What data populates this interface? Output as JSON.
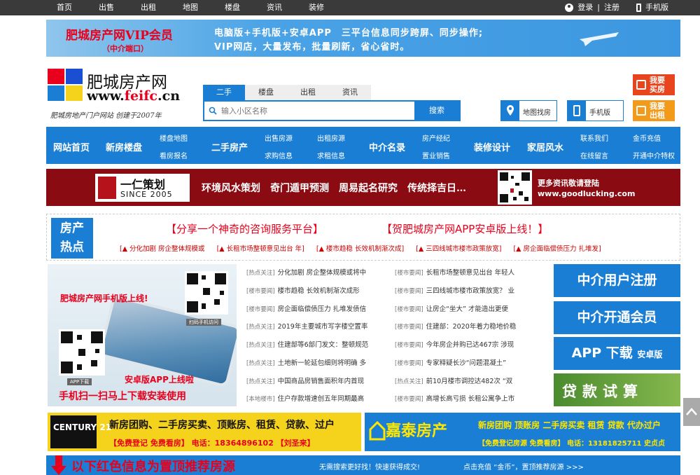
{
  "topnav": {
    "items": [
      "首页",
      "出售",
      "出租",
      "地图",
      "楼盘",
      "资讯",
      "装修"
    ],
    "login": "登录",
    "separator": "|",
    "register": "注册",
    "mobile": "手机版"
  },
  "vip_banner": {
    "title": "肥城房产网VIP会员",
    "subtitle": "（中介端口）",
    "line1": "电脑版+手机版+安卓APP　三平台信息同步跨屏、同步操作;",
    "line2": "VIP网店，大量发布，批量刷新，省心省时。"
  },
  "logo": {
    "name": "肥城房产网",
    "url_prefix": "www.",
    "url_highlight": "feifc",
    "url_suffix": ".cn",
    "slogan": "肥城房地产门户网站 创建于2007年"
  },
  "search": {
    "tabs": [
      "二手",
      "楼盘",
      "出租",
      "资讯"
    ],
    "active_tab": "二手",
    "placeholder": "输入小区名称",
    "button": "搜索"
  },
  "quick_buttons": {
    "map": "地图找房",
    "mobile": "手机版",
    "buy": [
      "我要",
      "买房"
    ],
    "sell": [
      "我要",
      "出租"
    ]
  },
  "main_nav": {
    "home": "网站首页",
    "new_house": "新房楼盘",
    "map_link": "楼盘地图",
    "viewing": "看房报名",
    "second_hand": "二手房产",
    "sell_src": "出售房源",
    "buy_info": "求购信息",
    "rent_src": "出租房源",
    "rent_info": "求租信息",
    "agents": "中介名录",
    "broker": "房产经纪",
    "property_sales": "置业销售",
    "decoration": "装修设计",
    "fengshui": "家居风水",
    "contact": "联系我们",
    "message": "在线留言",
    "recharge": "金币充值",
    "open_agent": "开通中介特权"
  },
  "ad_yiren": {
    "logo_text": "一仁策划",
    "since": "SINCE 2005",
    "middle": "环境风水策划　奇门遁甲预测　周易起名研究　传统择吉日…",
    "right1": "更多资讯敬请登陆",
    "right2": "www.goodlucking.com"
  },
  "hot": {
    "tag1": "房产",
    "tag2": "热点",
    "headline1": "【分享一个神奇的咨询服务平台】",
    "headline2": "【贺肥城房产网APP安卓版上线！】",
    "links": [
      "[▲ 分化加剧 房企整体规模或",
      "[▲ 长租市场整顿意见出台 年]",
      "[▲ 楼市趋稳 长效机制渐次成]",
      "[▲ 三四线城市楼市政策放宽]",
      "[▲ 房企面临偿债压力 扎堆发]"
    ]
  },
  "phone_ad": {
    "title": "肥城房产网手机版上线!",
    "qr_caption": "扫码手机访问",
    "app_caption": "APP下载",
    "android": "安卓版APP上线啦",
    "scan": "手机扫一扫马上下载安装使用"
  },
  "news_left": [
    {
      "cat": "[热点关注]",
      "title": "分化加剧 房企整体规模或将中"
    },
    {
      "cat": "[楼市要闻]",
      "title": "楼市趋稳 长效机制渐次成形"
    },
    {
      "cat": "[楼市要闻]",
      "title": "房企面临偿债压力 扎堆发债信"
    },
    {
      "cat": "[热点关注]",
      "title": "2019年主要城市写字楼空置率"
    },
    {
      "cat": "[热点关注]",
      "title": "住建部等6部门发文：整顿规范"
    },
    {
      "cat": "[热点关注]",
      "title": "土地新一轮延包细则将明确 多"
    },
    {
      "cat": "[热点关注]",
      "title": "中国商品房销售面积年内首现"
    },
    {
      "cat": "[本地楼市]",
      "title": "住户存款增速创五年同期最高"
    }
  ],
  "news_right": [
    {
      "cat": "[楼市要闻]",
      "title": "长租市场整顿意见出台 年轻人"
    },
    {
      "cat": "[楼市要闻]",
      "title": "三四线城市楼市政策放宽？ 业"
    },
    {
      "cat": "[楼市要闻]",
      "title": "让房企“坐大” 才能造出更便"
    },
    {
      "cat": "[楼市要闻]",
      "title": "住建部：2020年着力稳地价稳"
    },
    {
      "cat": "[楼市要闻]",
      "title": "今年房企并购已达467宗 涉现"
    },
    {
      "cat": "[楼市要闻]",
      "title": "专家释疑长沙“问题混凝土”"
    },
    {
      "cat": "[热点关注]",
      "title": "前10月楼市调控达482次 “双"
    },
    {
      "cat": "[楼市要闻]",
      "title": "高增长高亏损 长租公寓争上市"
    }
  ],
  "right_buttons": {
    "register": "中介用户注册",
    "vip": "中介开通会员",
    "app": "APP 下载",
    "app_small": "安卓版",
    "loan": "贷款试算"
  },
  "ad_century": {
    "logo": "CENTURY 21",
    "line1": "新房团购、二手房买卖、顶账房、租赁、贷款、过户",
    "line2": "【免费登记 免费看房】 电话：18364896102 【刘圣来】"
  },
  "ad_jiatai": {
    "logo": "嘉泰房产",
    "line1": "新房团购 顶账房 二手房买卖 租赁 贷款 代办过户",
    "line2": "【免费登记房源 免费看房】 电话：13181825711 史贞贞"
  },
  "bottom_banner": {
    "big": "以下红色信息为置顶推荐房源",
    "middle": "无需搜索更好找！快速获得成交!",
    "right": "点击充值 “金币”，置顶推荐房源 >>>"
  },
  "colors": {
    "blue": "#1a7fd4",
    "red": "#e8001c",
    "dark": "#3a3a3a"
  }
}
